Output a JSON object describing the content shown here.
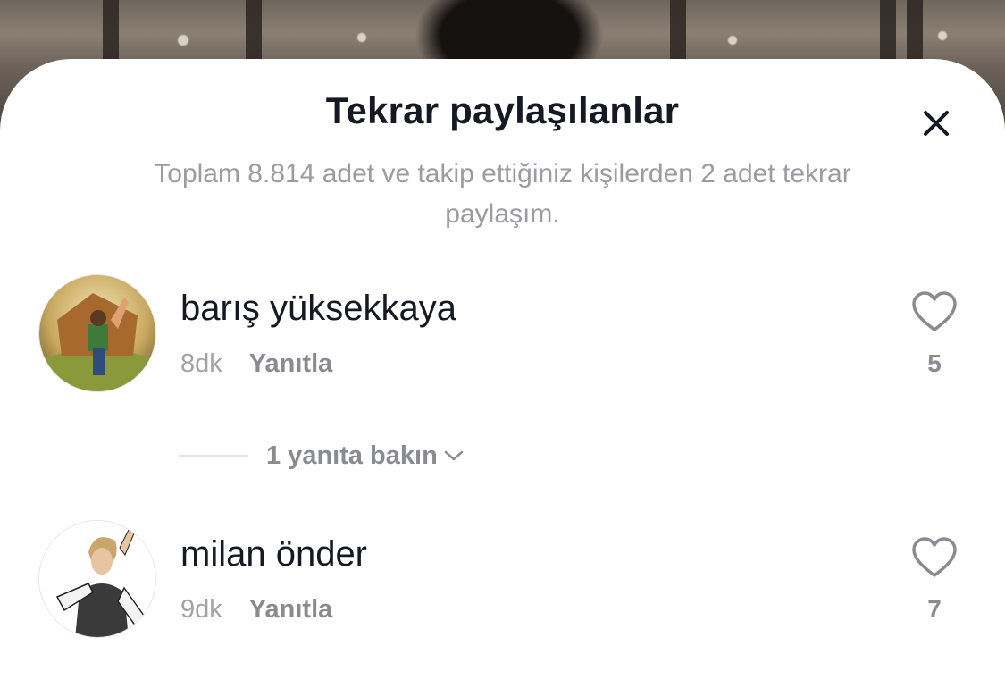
{
  "sheet": {
    "title": "Tekrar paylaşılanlar",
    "subtitle": "Toplam 8.814 adet ve takip ettiğiniz kişilerden 2 adet tekrar paylaşım."
  },
  "icons": {
    "close": "close-icon",
    "like": "heart-outline-icon",
    "expand": "chevron-down-icon"
  },
  "reposts": [
    {
      "username": "barış yüksekkaya",
      "time": "8dk",
      "reply_label": "Yanıtla",
      "likes": "5"
    },
    {
      "username": "milan önder",
      "time": "9dk",
      "reply_label": "Yanıtla",
      "likes": "7"
    }
  ],
  "view_replies": {
    "label": "1 yanıta bakın"
  },
  "colors": {
    "primary_text": "#161823",
    "secondary_text": "#8a8b91",
    "muted_text": "#9b9ba0",
    "sheet_background": "#ffffff"
  }
}
